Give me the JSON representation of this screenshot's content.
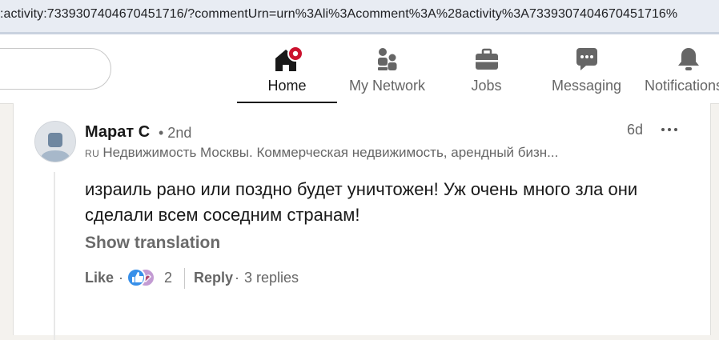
{
  "browser": {
    "url": ":activity:7339307404670451716/?commentUrn=urn%3Ali%3Acomment%3A%28activity%3A7339307404670451716%"
  },
  "nav": {
    "items": [
      {
        "label": "Home",
        "icon": "home-icon",
        "active": true
      },
      {
        "label": "My Network",
        "icon": "network-icon"
      },
      {
        "label": "Jobs",
        "icon": "briefcase-icon"
      },
      {
        "label": "Messaging",
        "icon": "messaging-icon"
      },
      {
        "label": "Notifications",
        "icon": "bell-icon"
      }
    ]
  },
  "comment": {
    "author": "Марат С",
    "degree": "• 2nd",
    "flag": "RU",
    "headline": "Недвижимость Москвы. Коммерческая недвижимость, арендный бизн...",
    "time": "6d",
    "text": "израиль рано или поздно будет уничтожен! Уж очень много зла они сделали всем соседним странам!",
    "translate_label": "Show translation",
    "like_label": "Like",
    "dot": "·",
    "reaction_count": "2",
    "reply_label": "Reply",
    "replies_label": "3 replies"
  },
  "colors": {
    "notification_badge": "#cb112d",
    "like_reaction": "#378fe9",
    "support_reaction": "#c39bd3"
  }
}
